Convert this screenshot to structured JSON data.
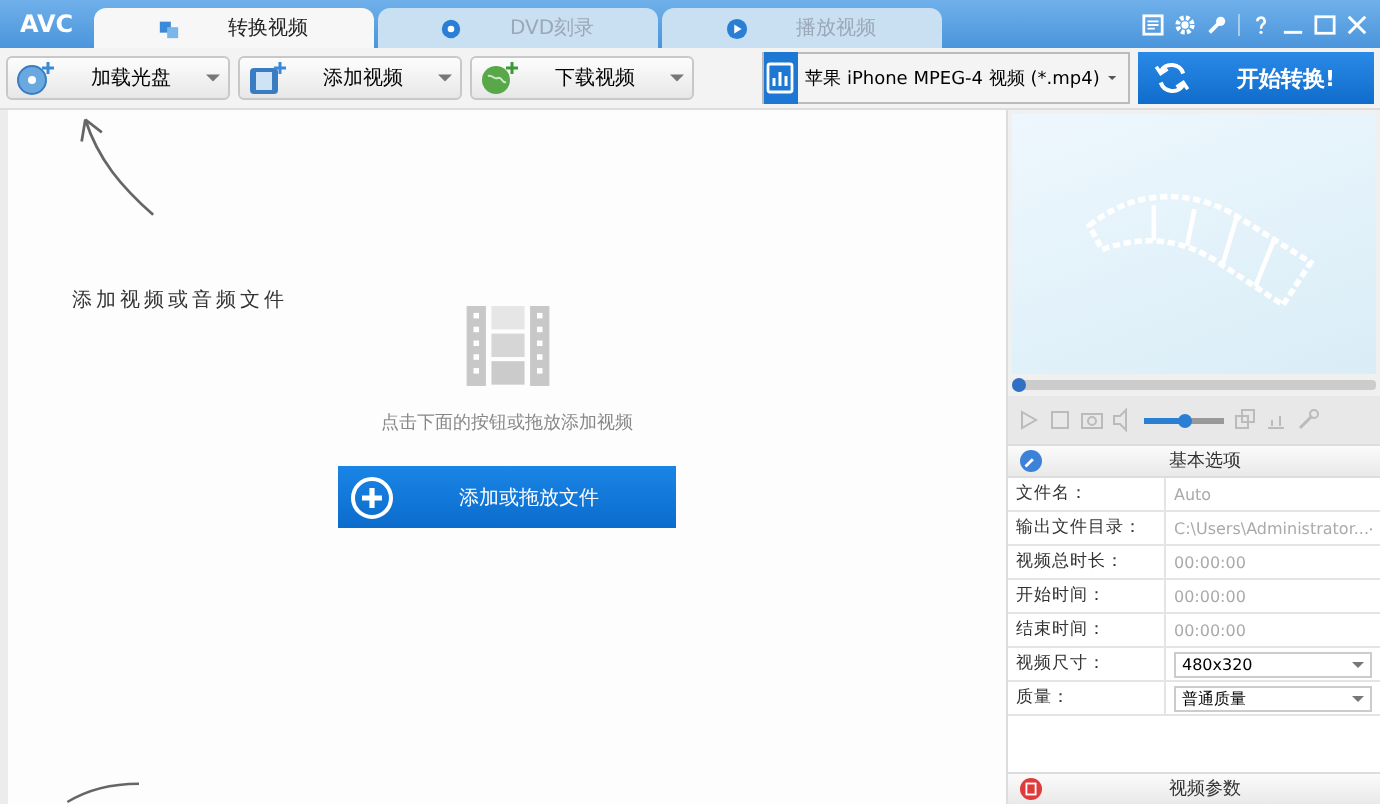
{
  "app": {
    "logo": "AVC"
  },
  "tabs": [
    {
      "label": "转换视频",
      "selected": true,
      "kind": "convert"
    },
    {
      "label": "DVD刻录",
      "selected": false,
      "kind": "disc"
    },
    {
      "label": "播放视频",
      "selected": false,
      "kind": "play"
    }
  ],
  "toolbar": {
    "buttons": [
      {
        "label": "加载光盘",
        "kind": "disc"
      },
      {
        "label": "添加视频",
        "kind": "film"
      },
      {
        "label": "下载视频",
        "kind": "globe"
      }
    ],
    "profile": "苹果 iPhone MPEG-4 视频 (*.mp4)",
    "convert": "开始转换!"
  },
  "workspace": {
    "hint_label": "添加视频或音频文件",
    "instruction": "点击下面的按钮或拖放添加视频",
    "add_button": "添加或拖放文件"
  },
  "preview": {
    "seek": {
      "level": 0
    },
    "volume": {
      "level": 0.5
    }
  },
  "options": {
    "title": "基本选项",
    "rows": [
      {
        "label": "文件名：",
        "value": "Auto",
        "kind": "text"
      },
      {
        "label": "输出文件目录：",
        "value": "C:\\Users\\Administrator...",
        "kind": "path"
      },
      {
        "label": "视频总时长：",
        "value": "00:00:00",
        "kind": "text"
      },
      {
        "label": "开始时间：",
        "value": "00:00:00",
        "kind": "text"
      },
      {
        "label": "结束时间：",
        "value": "00:00:00",
        "kind": "text"
      },
      {
        "label": "视频尺寸：",
        "value": "480x320",
        "kind": "select"
      },
      {
        "label": "质量：",
        "value": "普通质量",
        "kind": "select"
      }
    ],
    "footer": "视频参数"
  }
}
